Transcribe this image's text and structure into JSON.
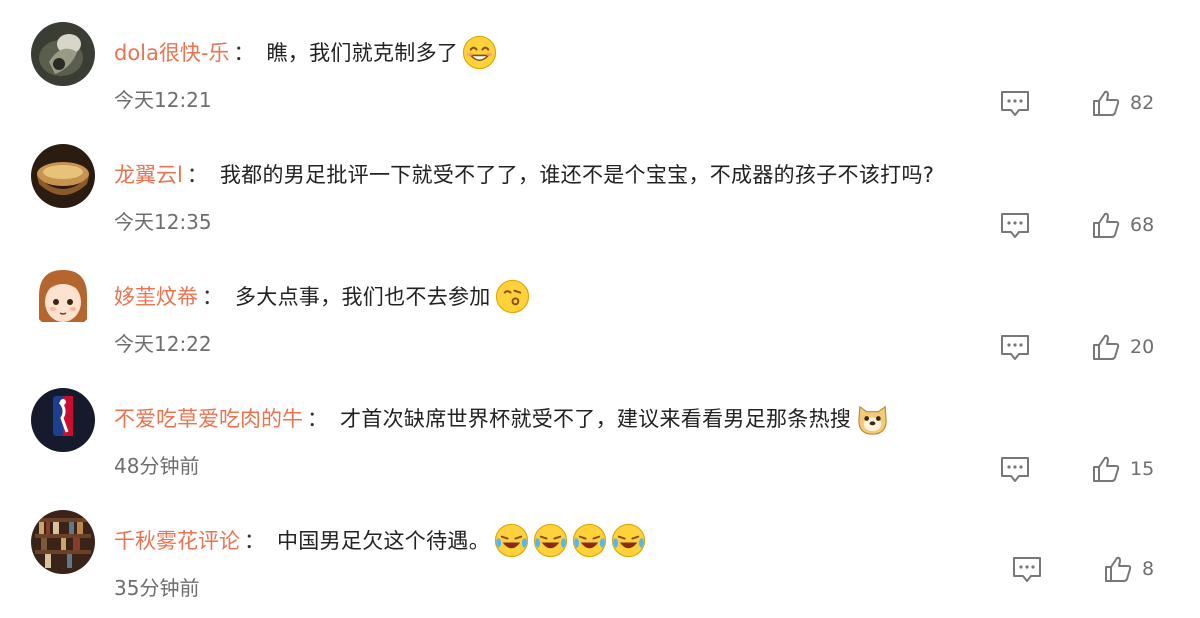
{
  "separator": "：",
  "comments": [
    {
      "username": "dola很快-乐",
      "text": "瞧，我们就克制多了",
      "emojis": [
        "smile-emoji"
      ],
      "time": "今天12:21",
      "likes": "82",
      "reply_icon": "comment-icon",
      "like_icon": "thumbs-up-icon"
    },
    {
      "username": "龙翼云l",
      "text": "我都的男足批评一下就受不了了，谁还不是个宝宝，不成器的孩子不该打吗?",
      "emojis": [],
      "time": "今天12:35",
      "likes": "68",
      "reply_icon": "comment-icon",
      "like_icon": "thumbs-up-icon"
    },
    {
      "username": "姼茥炆帣",
      "text": "多大点事，我们也不去参加",
      "emojis": [
        "whistle-emoji"
      ],
      "time": "今天12:22",
      "likes": "20",
      "reply_icon": "comment-icon",
      "like_icon": "thumbs-up-icon"
    },
    {
      "username": "不爱吃草爱吃肉的牛",
      "text": "才首次缺席世界杯就受不了，建议来看看男足那条热搜",
      "emojis": [
        "doge-emoji"
      ],
      "time": "48分钟前",
      "likes": "15",
      "reply_icon": "comment-icon",
      "like_icon": "thumbs-up-icon"
    },
    {
      "username": "千秋雾花评论",
      "text": "中国男足欠这个待遇。",
      "emojis": [
        "laugh-cry-emoji",
        "laugh-cry-emoji",
        "laugh-cry-emoji",
        "laugh-cry-emoji"
      ],
      "time": "35分钟前",
      "likes": "8",
      "reply_icon": "comment-icon",
      "like_icon": "thumbs-up-icon"
    }
  ],
  "colors": {
    "username": "#eb7350",
    "text": "#222222",
    "meta": "#6e6e6e",
    "emoji_yellow": "#ffd23c"
  }
}
